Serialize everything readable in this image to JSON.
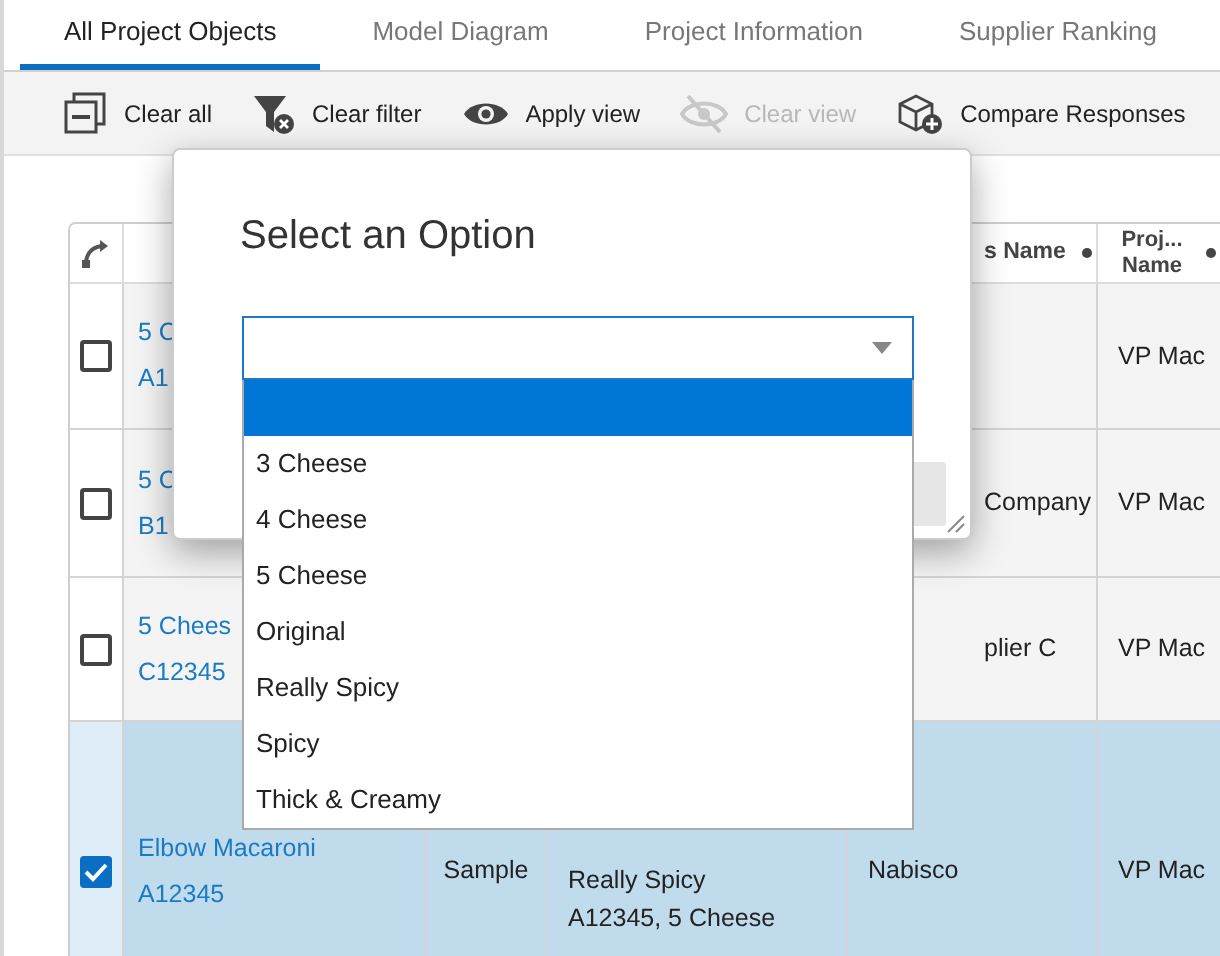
{
  "tabs": [
    {
      "label": "All Project Objects",
      "selected": true
    },
    {
      "label": "Model Diagram",
      "selected": false
    },
    {
      "label": "Project Information",
      "selected": false
    },
    {
      "label": "Supplier Ranking",
      "selected": false
    }
  ],
  "toolbar": [
    {
      "kind": "clear-all",
      "label": "Clear all",
      "disabled": false
    },
    {
      "kind": "clear-filter",
      "label": "Clear filter",
      "disabled": false
    },
    {
      "kind": "apply-view",
      "label": "Apply view",
      "disabled": false
    },
    {
      "kind": "clear-view",
      "label": "Clear view",
      "disabled": true
    },
    {
      "kind": "compare",
      "label": "Compare Responses",
      "disabled": false
    }
  ],
  "table": {
    "columns": [
      {
        "label": "s Name"
      },
      {
        "label": "Proj... Name"
      }
    ],
    "rows": [
      {
        "checked": false,
        "selected": false,
        "name": [
          "5 C",
          "A1"
        ],
        "column_3": [],
        "column_4": [],
        "supplier": [],
        "project": [
          "VP Mac"
        ]
      },
      {
        "checked": false,
        "selected": false,
        "name": [
          "5 C",
          "B1"
        ],
        "column_3": [],
        "column_4": [],
        "supplier": [
          "Company"
        ],
        "project": [
          "VP Mac"
        ]
      },
      {
        "checked": false,
        "selected": false,
        "name": [
          "5 Chees",
          "C12345"
        ],
        "column_3": [],
        "column_4": [],
        "supplier": [
          "plier C"
        ],
        "project": [
          "VP Mac"
        ]
      },
      {
        "checked": true,
        "selected": true,
        "name": [
          "Elbow Macaroni",
          "A12345"
        ],
        "column_3": [
          "Sample"
        ],
        "column_4": [
          "Really Spicy",
          "A12345, 5 Cheese"
        ],
        "supplier": [
          "Nabisco"
        ],
        "project": [
          "VP Mac"
        ]
      }
    ]
  },
  "dialog": {
    "title": "Select an Option",
    "options": [
      {
        "selected": true
      },
      {
        "label": "3 Cheese",
        "selected": false
      },
      {
        "label": "4 Cheese",
        "selected": false
      },
      {
        "label": "5 Cheese",
        "selected": false
      },
      {
        "label": "Original",
        "selected": false
      },
      {
        "label": "Really Spicy",
        "selected": false
      },
      {
        "label": "Spicy",
        "selected": false
      },
      {
        "label": "Thick & Creamy",
        "selected": false
      }
    ]
  }
}
